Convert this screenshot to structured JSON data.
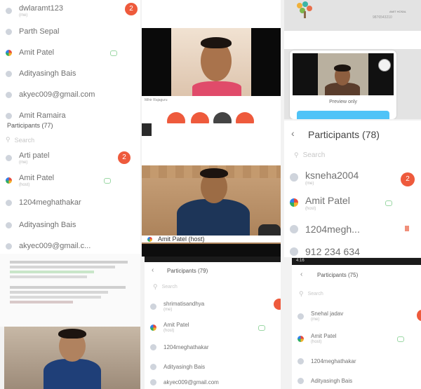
{
  "panel_a": {
    "rows": [
      {
        "name": "dwlaramt123",
        "sub": "(me)"
      },
      {
        "name": "Parth Sepal",
        "sub": ""
      },
      {
        "name": "Amit Patel",
        "sub": ""
      },
      {
        "name": "Adityasingh Bais",
        "sub": ""
      },
      {
        "name": "akyec009@gmail.com",
        "sub": ""
      },
      {
        "name": "Amit Ramaira",
        "sub": ""
      }
    ],
    "badge": "2"
  },
  "panel_b": {
    "title": "Participants (77)",
    "search_placeholder": "Search",
    "rows": [
      {
        "name": "Arti patel",
        "sub": "(me)"
      },
      {
        "name": "Amit Patel",
        "sub": "(host)"
      },
      {
        "name": "1204meghathakar",
        "sub": ""
      },
      {
        "name": "Adityasingh Bais",
        "sub": ""
      },
      {
        "name": "akyec009@gmail.c...",
        "sub": ""
      }
    ],
    "badge": "2"
  },
  "video_top": {
    "caption": "Mihir Rajaguru"
  },
  "video_mid": {
    "caption": "Amit Patel (host)"
  },
  "preview": {
    "label": "Preview only",
    "brand": "AMIT HOSAL",
    "sub": "9876543210"
  },
  "panel_right": {
    "title": "Participants (78)",
    "search_placeholder": "Search",
    "rows": [
      {
        "name": "ksneha2004",
        "sub": "(me)"
      },
      {
        "name": "Amit Patel",
        "sub": "(host)"
      },
      {
        "name": "1204megh...",
        "sub": ""
      },
      {
        "name": "912 234 634",
        "sub": ""
      }
    ],
    "badge": "2"
  },
  "panel_mid_bottom": {
    "title": "Participants (79)",
    "search_placeholder": "Search",
    "rows": [
      {
        "name": "shrimatisandhya",
        "sub": "(me)"
      },
      {
        "name": "Amit Patel",
        "sub": "(host)"
      },
      {
        "name": "1204meghathakar",
        "sub": ""
      },
      {
        "name": "Adityasingh Bais",
        "sub": ""
      },
      {
        "name": "akyec009@gmail.com",
        "sub": ""
      }
    ]
  },
  "panel_right_bottom": {
    "status_time": "4:16",
    "title": "Participants (75)",
    "search_placeholder": "Search",
    "rows": [
      {
        "name": "Snehal jadav",
        "sub": "(me)"
      },
      {
        "name": "Amit Patel",
        "sub": "(host)"
      },
      {
        "name": "1204meghathakar",
        "sub": ""
      },
      {
        "name": "Adityasingh Bais",
        "sub": ""
      }
    ]
  },
  "colors": {
    "accent": "#ee5a3c",
    "mic_green": "#9ad7a4",
    "preview_button": "#4fc3f7"
  }
}
